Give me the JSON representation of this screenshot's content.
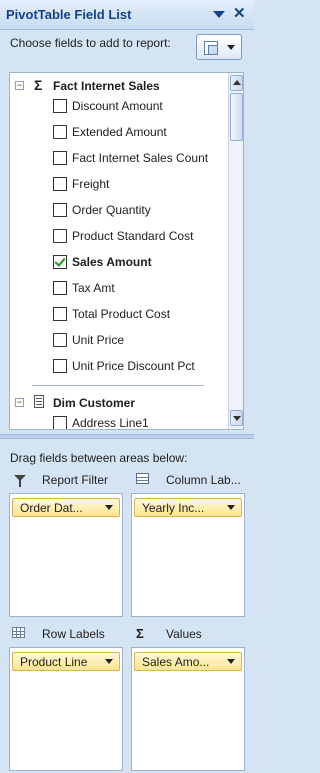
{
  "title": "PivotTable Field List",
  "choose_text": "Choose fields to add to report:",
  "tables": [
    {
      "name": "Fact Internet Sales",
      "icon": "sigma-icon",
      "expander": "−"
    },
    {
      "name": "Dim Customer",
      "icon": "table-icon",
      "expander": "−"
    }
  ],
  "fields": [
    {
      "label": "Discount Amount",
      "checked": false
    },
    {
      "label": "Extended Amount",
      "checked": false
    },
    {
      "label": "Fact Internet Sales Count",
      "checked": false
    },
    {
      "label": "Freight",
      "checked": false
    },
    {
      "label": "Order Quantity",
      "checked": false
    },
    {
      "label": "Product Standard Cost",
      "checked": false
    },
    {
      "label": "Sales Amount",
      "checked": true
    },
    {
      "label": "Tax Amt",
      "checked": false
    },
    {
      "label": "Total Product Cost",
      "checked": false
    },
    {
      "label": "Unit Price",
      "checked": false
    },
    {
      "label": "Unit Price Discount Pct",
      "checked": false
    }
  ],
  "customer_fields": [
    {
      "label": "Address Line1",
      "checked": false
    }
  ],
  "drag_label": "Drag fields between areas below:",
  "areas": {
    "report_filter": {
      "label": "Report Filter",
      "chip": "Order Dat..."
    },
    "column_labels": {
      "label": "Column Lab...",
      "chip": "Yearly Inc..."
    },
    "row_labels": {
      "label": "Row Labels",
      "chip": "Product Line"
    },
    "values": {
      "label": "Values",
      "chip": "Sales Amo..."
    }
  },
  "icons": {
    "sigma": "Σ",
    "close": "✕"
  }
}
